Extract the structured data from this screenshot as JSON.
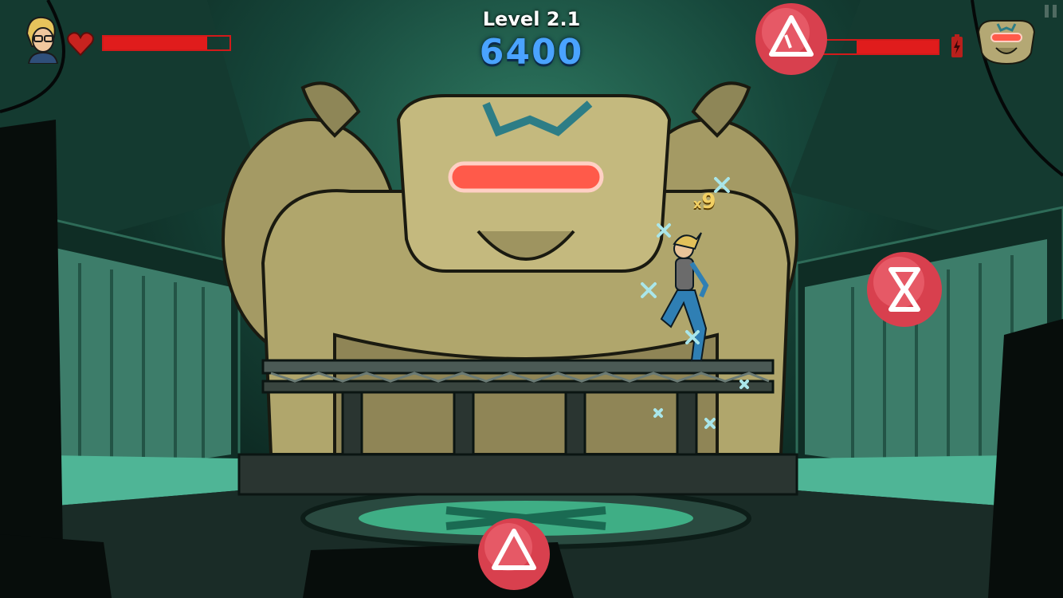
{
  "hud": {
    "level_label": "Level 2.1",
    "score": "6400",
    "player_health_fraction": 0.82,
    "boss_health_fraction": 0.63,
    "combo_prefix": "x",
    "combo_value": "9"
  },
  "colors": {
    "health_red": "#e01c1c",
    "score_blue": "#4aa3ff",
    "orb_pink": "#e0455a",
    "floor_green": "#3fae85"
  },
  "icons": {
    "player_avatar": "player-portrait-icon",
    "heart": "heart-icon",
    "boss_avatar": "boss-robot-portrait-icon",
    "battery": "battery-bolt-icon",
    "pause": "pause-icon",
    "attack_orb": "triangle-orb-icon",
    "time_orb": "hourglass-orb-icon"
  }
}
